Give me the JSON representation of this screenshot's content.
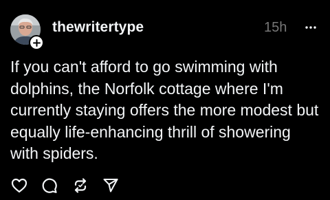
{
  "post": {
    "username": "thewritertype",
    "timestamp": "15h",
    "text": "If you can't afford to go swimming with dolphins, the Norfolk cottage where I'm currently staying offers the more modest but equally life-enhancing thrill of showering with spiders."
  },
  "icons": {
    "more": "more-horizontal-icon",
    "follow": "plus-icon",
    "like": "heart-icon",
    "reply": "comment-icon",
    "repost": "repost-icon",
    "share": "send-icon"
  },
  "colors": {
    "background": "#000000",
    "text": "#f3f5f7",
    "muted": "#777777"
  }
}
